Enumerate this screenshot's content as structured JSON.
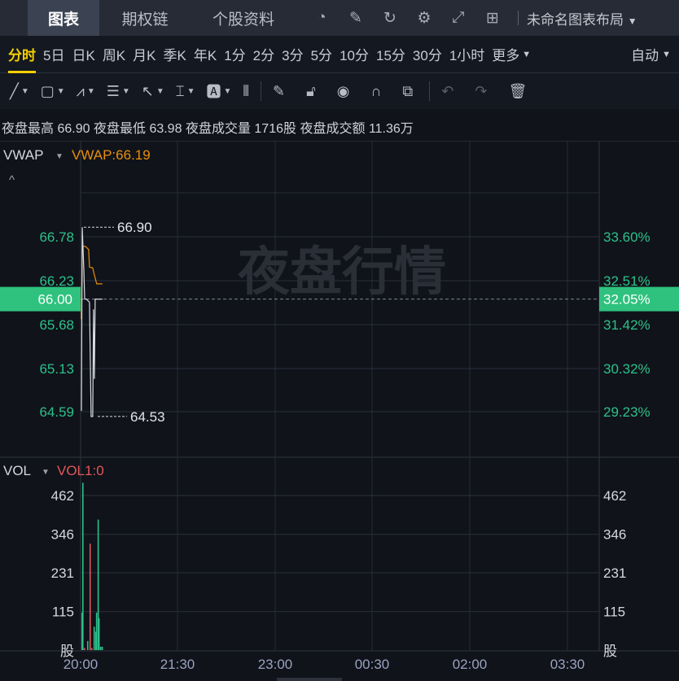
{
  "top": {
    "tabs": [
      "图表",
      "期权链",
      "个股资料"
    ],
    "active": 0,
    "icons": [
      "gauge-icon",
      "edit-icon",
      "refresh-icon",
      "settings-icon",
      "fullscreen-icon",
      "grid-layout-icon"
    ],
    "layout_label": "未命名图表布局"
  },
  "periods": {
    "items": [
      "分时",
      "5日",
      "日K",
      "周K",
      "月K",
      "季K",
      "年K",
      "1分",
      "2分",
      "3分",
      "5分",
      "10分",
      "15分",
      "30分",
      "1小时"
    ],
    "more": "更多",
    "active": 0,
    "mode": "自动"
  },
  "tools": [
    "line-tool-icon",
    "rectangle-tool-icon",
    "pattern-tool-icon",
    "fibonacci-tool-icon",
    "arrow-tool-icon",
    "measure-tool-icon",
    "text-tool-icon",
    "indicator-icon",
    "pen-icon",
    "unlock-icon",
    "eye-icon",
    "magnet-icon",
    "link-icon",
    "undo-icon",
    "redo-icon",
    "trash-icon"
  ],
  "info": {
    "high_label": "夜盘最高",
    "high": "66.90",
    "low_label": "夜盘最低",
    "low": "63.98",
    "vol_label": "夜盘成交量",
    "vol": "1716股",
    "amt_label": "夜盘成交额",
    "amt": "11.36万"
  },
  "price_pane": {
    "indicator": "VWAP",
    "vwap_label": "VWAP:66.19",
    "watermark": "夜盘行情",
    "left_ticks": [
      "66.78",
      "66.23",
      "65.68",
      "65.13",
      "64.59"
    ],
    "right_ticks": [
      "33.60%",
      "32.51%",
      "31.42%",
      "30.32%",
      "29.23%"
    ],
    "current_price": "66.00",
    "current_pct": "32.05%",
    "max_label": "66.90",
    "min_label": "64.53"
  },
  "vol_pane": {
    "indicator": "VOL",
    "vol_label": "VOL1:0",
    "ticks": [
      "462",
      "346",
      "231",
      "115"
    ],
    "unit": "股"
  },
  "x_ticks": [
    "20:00",
    "21:30",
    "23:00",
    "00:30",
    "02:00",
    "03:30"
  ],
  "colors": {
    "up": "#2dc08a",
    "down": "#e0585b",
    "vwap": "#e8900c",
    "price": "#d9dce2",
    "active": "#f5d000"
  },
  "chart_data": {
    "type": "line",
    "x_unit": "minutes since 20:00",
    "price": [
      [
        0,
        64.6
      ],
      [
        1,
        66.9
      ],
      [
        3,
        66.36
      ],
      [
        4,
        66.0
      ],
      [
        6,
        66.0
      ],
      [
        10,
        65.96
      ],
      [
        12,
        64.53
      ],
      [
        14,
        64.53
      ],
      [
        15,
        65.87
      ],
      [
        16,
        65.0
      ],
      [
        17,
        66.0
      ],
      [
        26,
        66.0
      ]
    ],
    "vwap": [
      [
        0,
        65.75
      ],
      [
        1,
        66.66
      ],
      [
        5,
        66.66
      ],
      [
        9,
        66.62
      ],
      [
        10,
        66.4
      ],
      [
        14,
        66.39
      ],
      [
        16,
        66.3
      ],
      [
        19,
        66.19
      ],
      [
        26,
        66.19
      ]
    ],
    "volume": [
      [
        0,
        112,
        "up"
      ],
      [
        1,
        500,
        "up"
      ],
      [
        3,
        6,
        "down"
      ],
      [
        7,
        27,
        "up"
      ],
      [
        10,
        318,
        "down"
      ],
      [
        12,
        6,
        "down"
      ],
      [
        15,
        70,
        "up"
      ],
      [
        17,
        55,
        "up"
      ],
      [
        18,
        112,
        "up"
      ],
      [
        20,
        390,
        "up"
      ],
      [
        21,
        95,
        "up"
      ],
      [
        23,
        10,
        "up"
      ],
      [
        25,
        10,
        "up"
      ]
    ]
  }
}
